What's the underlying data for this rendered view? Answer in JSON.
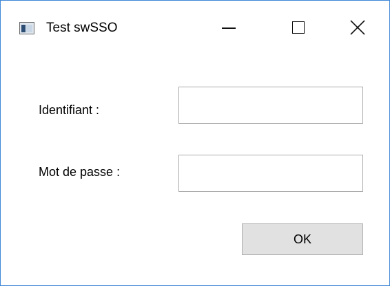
{
  "window": {
    "title": "Test swSSO",
    "icon": "app-window-icon",
    "controls": {
      "minimize_icon": "minimize-icon",
      "maximize_icon": "maximize-icon",
      "close_icon": "close-icon"
    },
    "accent_color": "#3c86d6"
  },
  "form": {
    "username": {
      "label": "Identifiant :",
      "value": ""
    },
    "password": {
      "label": "Mot de passe :",
      "value": ""
    },
    "ok_label": "OK"
  }
}
